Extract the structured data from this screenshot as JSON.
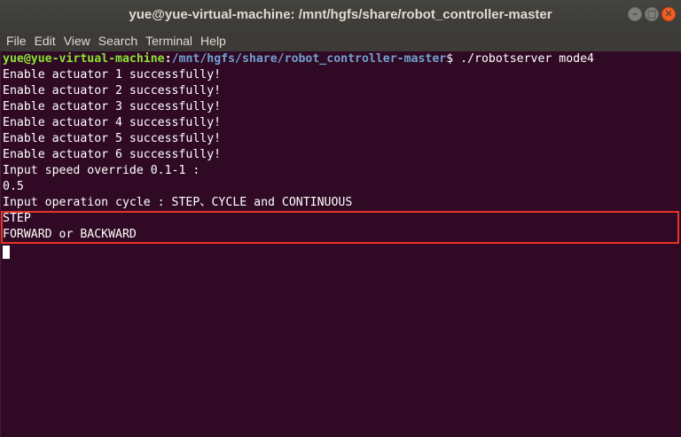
{
  "window": {
    "title": "yue@yue-virtual-machine: /mnt/hgfs/share/robot_controller-master",
    "controls": {
      "minimize_icon": "–",
      "maximize_icon": "□",
      "close_icon": "✕"
    }
  },
  "menubar": {
    "items": [
      "File",
      "Edit",
      "View",
      "Search",
      "Terminal",
      "Help"
    ]
  },
  "terminal": {
    "prompt": {
      "user_host": "yue@yue-virtual-machine",
      "separator": ":",
      "path": "/mnt/hgfs/share/robot_controller-master",
      "symbol": "$",
      "command": " ./robotserver mode4"
    },
    "output_lines": [
      "Enable actuator 1 successfully!",
      "Enable actuator 2 successfully!",
      "Enable actuator 3 successfully!",
      "Enable actuator 4 successfully!",
      "Enable actuator 5 successfully!",
      "Enable actuator 6 successfully!",
      "Input speed override 0.1-1 :",
      "0.5",
      "Input operation cycle : STEP、CYCLE and CONTINUOUS"
    ],
    "highlighted_lines": [
      "STEP",
      "FORWARD or BACKWARD"
    ]
  },
  "colors": {
    "terminal_bg": "#300a24",
    "prompt_user": "#8ae234",
    "prompt_path": "#729fcf",
    "highlight_border": "#e8322a",
    "close_button": "#f15d22"
  }
}
